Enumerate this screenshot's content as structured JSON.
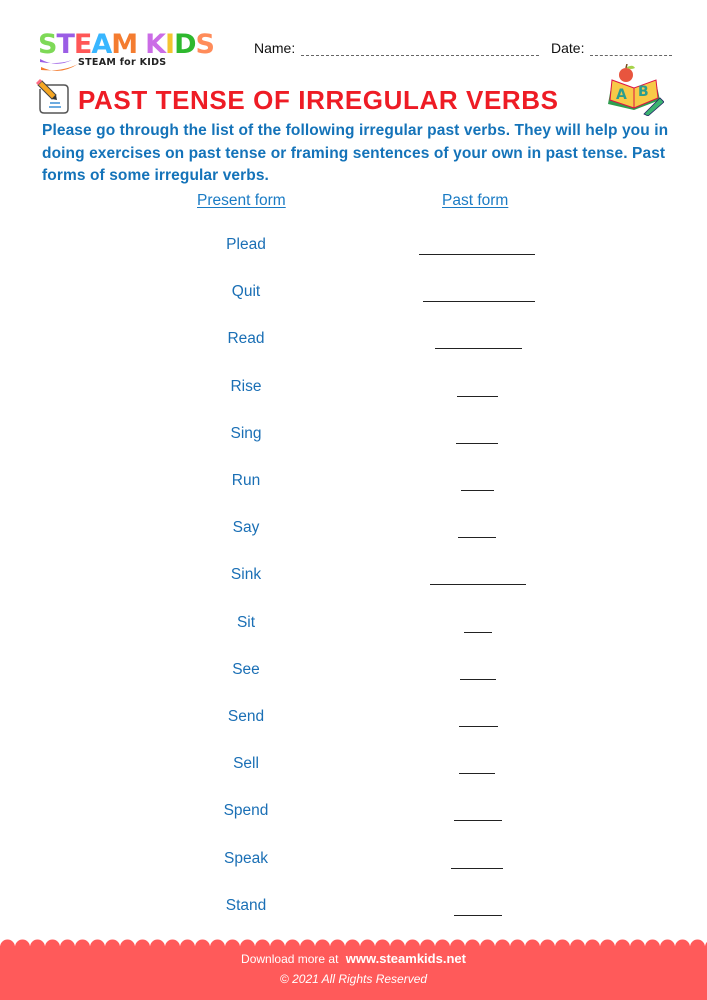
{
  "header": {
    "logo": {
      "letters": [
        {
          "char": "S",
          "color": "#7ed957"
        },
        {
          "char": "T",
          "color": "#9b5de5"
        },
        {
          "char": "E",
          "color": "#ff5757"
        },
        {
          "char": "A",
          "color": "#38b6ff"
        },
        {
          "char": "M",
          "color": "#f47c30"
        },
        {
          "char": " ",
          "color": "#ffffff"
        },
        {
          "char": "K",
          "color": "#cb6ce6"
        },
        {
          "char": "I",
          "color": "#f4c430"
        },
        {
          "char": "D",
          "color": "#2eb82e"
        },
        {
          "char": "S",
          "color": "#ff8c5a"
        }
      ],
      "tagline": "STEAM for KIDS"
    },
    "name_label": "Name:",
    "date_label": "Date:"
  },
  "title": "PAST TENSE OF IRREGULAR VERBS",
  "intro": "Please go through the list of the following irregular past verbs. They will help you in doing exercises on past tense or framing sentences of your own in past tense. Past forms of some irregular verbs.",
  "table": {
    "headers": {
      "present": "Present form",
      "past": "Past form"
    },
    "rows": [
      {
        "present": "Plead",
        "past": ""
      },
      {
        "present": "Quit",
        "past": ""
      },
      {
        "present": "Read",
        "past": ""
      },
      {
        "present": "Rise",
        "past": ""
      },
      {
        "present": "Sing",
        "past": ""
      },
      {
        "present": "Run",
        "past": ""
      },
      {
        "present": "Say",
        "past": ""
      },
      {
        "present": "Sink",
        "past": ""
      },
      {
        "present": "Sit",
        "past": ""
      },
      {
        "present": "See",
        "past": ""
      },
      {
        "present": "Send",
        "past": ""
      },
      {
        "present": "Sell",
        "past": ""
      },
      {
        "present": "Spend",
        "past": ""
      },
      {
        "present": "Speak",
        "past": ""
      },
      {
        "present": "Stand",
        "past": ""
      }
    ]
  },
  "footer": {
    "download_text": "Download more at",
    "link": "www.steamkids.net",
    "copyright": "© 2021 All Rights Reserved"
  },
  "colors": {
    "title": "#ee1c25",
    "intro": "#1473b9",
    "verb": "#1a6fb5",
    "footer": "#ff5a5a"
  }
}
